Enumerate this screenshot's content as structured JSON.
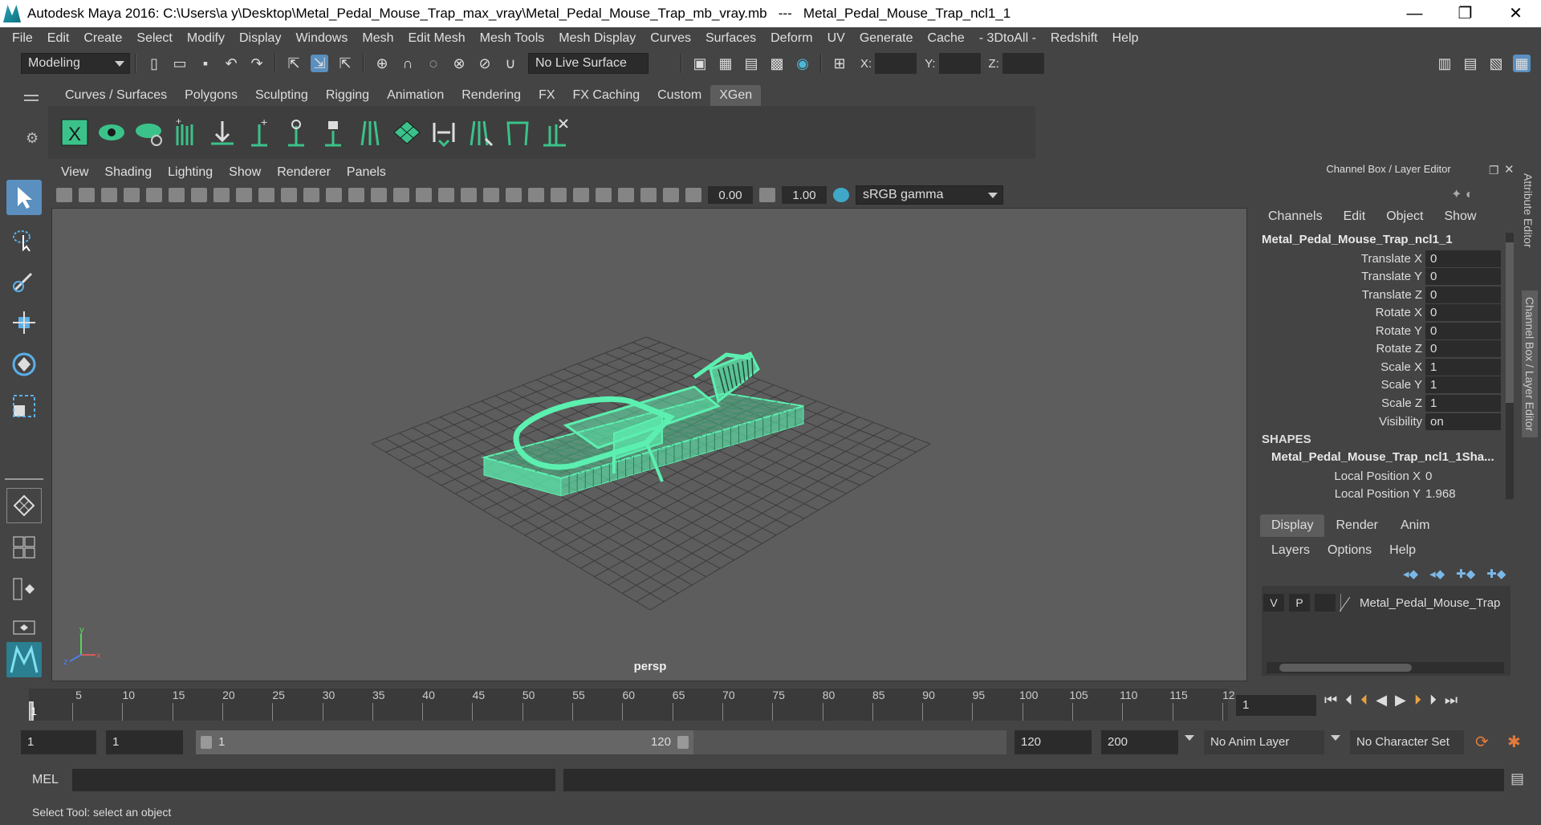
{
  "window": {
    "title": "Autodesk Maya 2016: C:\\Users\\a y\\Desktop\\Metal_Pedal_Mouse_Trap_max_vray\\Metal_Pedal_Mouse_Trap_mb_vray.mb   ---   Metal_Pedal_Mouse_Trap_ncl1_1",
    "minimize": "—",
    "maximize": "❐",
    "close": "✕"
  },
  "menubar": [
    "File",
    "Edit",
    "Create",
    "Select",
    "Modify",
    "Display",
    "Windows",
    "Mesh",
    "Edit Mesh",
    "Mesh Tools",
    "Mesh Display",
    "Curves",
    "Surfaces",
    "Deform",
    "UV",
    "Generate",
    "Cache",
    "- 3DtoAll -",
    "Redshift",
    "Help"
  ],
  "toolbar": {
    "mode": "Modeling",
    "live_surface": "No Live Surface",
    "x_label": "X:",
    "y_label": "Y:",
    "z_label": "Z:"
  },
  "shelf_tabs": [
    "Curves / Surfaces",
    "Polygons",
    "Sculpting",
    "Rigging",
    "Animation",
    "Rendering",
    "FX",
    "FX Caching",
    "Custom",
    "XGen"
  ],
  "viewport": {
    "menus": [
      "View",
      "Shading",
      "Lighting",
      "Show",
      "Renderer",
      "Panels"
    ],
    "exposure": "0.00",
    "gamma": "1.00",
    "color_space": "sRGB gamma",
    "camera": "persp",
    "mesh_color": "#5cf0b0"
  },
  "channel_box": {
    "title": "Channel Box / Layer Editor",
    "menus": [
      "Channels",
      "Edit",
      "Object",
      "Show"
    ],
    "object": "Metal_Pedal_Mouse_Trap_ncl1_1",
    "attributes": [
      {
        "label": "Translate X",
        "value": "0"
      },
      {
        "label": "Translate Y",
        "value": "0"
      },
      {
        "label": "Translate Z",
        "value": "0"
      },
      {
        "label": "Rotate X",
        "value": "0"
      },
      {
        "label": "Rotate Y",
        "value": "0"
      },
      {
        "label": "Rotate Z",
        "value": "0"
      },
      {
        "label": "Scale X",
        "value": "1"
      },
      {
        "label": "Scale Y",
        "value": "1"
      },
      {
        "label": "Scale Z",
        "value": "1"
      },
      {
        "label": "Visibility",
        "value": "on"
      }
    ],
    "shapes_header": "SHAPES",
    "shape_name": "Metal_Pedal_Mouse_Trap_ncl1_1Sha...",
    "local_positions": [
      {
        "label": "Local Position X",
        "value": "0"
      },
      {
        "label": "Local Position Y",
        "value": "1.968"
      }
    ]
  },
  "side_tabs": [
    "Attribute Editor",
    "Channel Box / Layer Editor"
  ],
  "layer_editor": {
    "tabs": [
      "Display",
      "Render",
      "Anim"
    ],
    "menus": [
      "Layers",
      "Options",
      "Help"
    ],
    "layer": {
      "v": "V",
      "p": "P",
      "name": "Metal_Pedal_Mouse_Trap"
    }
  },
  "timeline": {
    "ticks": [
      "1",
      "5",
      "10",
      "15",
      "20",
      "25",
      "30",
      "35",
      "40",
      "45",
      "50",
      "55",
      "60",
      "65",
      "70",
      "75",
      "80",
      "85",
      "90",
      "95",
      "100",
      "105",
      "110",
      "115",
      "12"
    ],
    "current_frame": "1"
  },
  "range": {
    "start": "1",
    "anim_start": "1",
    "slider_start": "1",
    "slider_end": "120",
    "end": "120",
    "anim_end": "200",
    "anim_layer": "No Anim Layer",
    "character_set": "No Character Set"
  },
  "command": {
    "label": "MEL"
  },
  "status": "Select Tool: select an object"
}
